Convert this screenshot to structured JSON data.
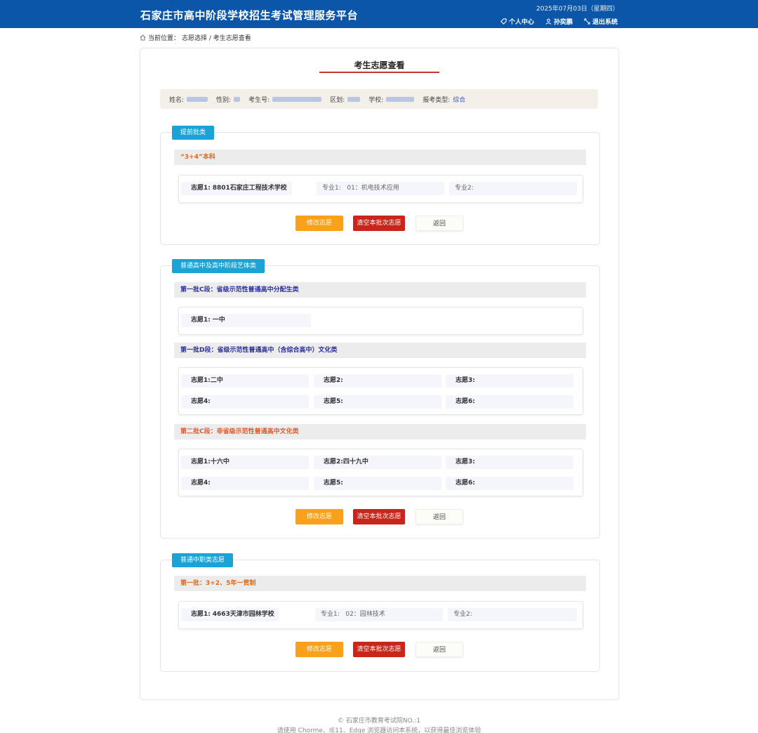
{
  "header": {
    "title": "石家庄市高中阶段学校招生考试管理服务平台",
    "date": "2025年07月03日（星期四）",
    "nav_profile": "个人中心",
    "nav_user": "孙奕鹏",
    "nav_logout": "退出系统"
  },
  "breadcrumb": {
    "label": "当前位置：",
    "path": "志愿选择 / 考生志愿查看"
  },
  "page": {
    "title": "考生志愿查看"
  },
  "student_info": {
    "name_label": "姓名:",
    "gender_label": "性别:",
    "exam_no_label": "考生号:",
    "district_label": "区划:",
    "school_label": "学校:",
    "type_label": "报考类型:",
    "type_value": "综合"
  },
  "sections": [
    {
      "tag": "提前批类",
      "categories": [
        {
          "title": "“3+4”本科",
          "choices": [
            {
              "label": "志愿1:",
              "value": "8801石家庄工程技术学校",
              "major1_label": "专业1:",
              "major1_value": "01：机电技术应用",
              "major2_label": "专业2:"
            }
          ]
        }
      ],
      "buttons": {
        "edit": "修改志愿",
        "clear": "清空本批次志愿",
        "back": "返回"
      }
    },
    {
      "tag": "普通高中及高中阶段艺体类",
      "categories": [
        {
          "title": "第一批C段：省级示范性普通高中分配生类",
          "choices": [
            {
              "label": "志愿1:",
              "value": "一中"
            }
          ]
        },
        {
          "title": "第一批D段：省级示范性普通高中（含综合高中）文化类",
          "choices": [
            {
              "label": "志愿1:",
              "value": "二中"
            },
            {
              "label": "志愿2:",
              "value": ""
            },
            {
              "label": "志愿3:",
              "value": ""
            },
            {
              "label": "志愿4:",
              "value": ""
            },
            {
              "label": "志愿5:",
              "value": ""
            },
            {
              "label": "志愿6:",
              "value": ""
            }
          ]
        },
        {
          "title": "第二批C段：非省级示范性普通高中文化类",
          "choices": [
            {
              "label": "志愿1:",
              "value": "十六中"
            },
            {
              "label": "志愿2:",
              "value": "四十九中"
            },
            {
              "label": "志愿3:",
              "value": ""
            },
            {
              "label": "志愿4:",
              "value": ""
            },
            {
              "label": "志愿5:",
              "value": ""
            },
            {
              "label": "志愿6:",
              "value": ""
            }
          ]
        }
      ],
      "buttons": {
        "edit": "修改志愿",
        "clear": "清空本批次志愿",
        "back": "返回"
      }
    },
    {
      "tag": "普通中职类志愿",
      "categories": [
        {
          "title": "第一批：3+2、5年一贯制",
          "choices": [
            {
              "label": "志愿1:",
              "value": "4663天津市园林学校",
              "major1_label": "专业1:",
              "major1_value": "02：园林技术",
              "major2_label": "专业2:"
            }
          ]
        }
      ],
      "buttons": {
        "edit": "修改志愿",
        "clear": "清空本批次志愿",
        "back": "返回"
      }
    }
  ],
  "footer": {
    "copyright": "© 石家庄市教育考试院NO.:1",
    "browser_note": "请使用 Chorme、IE11、Edge 浏览器访问本系统，以获得最佳浏览体验"
  },
  "colors": {
    "header_blue": "#0b56a8",
    "tag_blue": "#1aa3d6",
    "edit_orange": "#f9a11b",
    "clear_red": "#c8261b"
  }
}
